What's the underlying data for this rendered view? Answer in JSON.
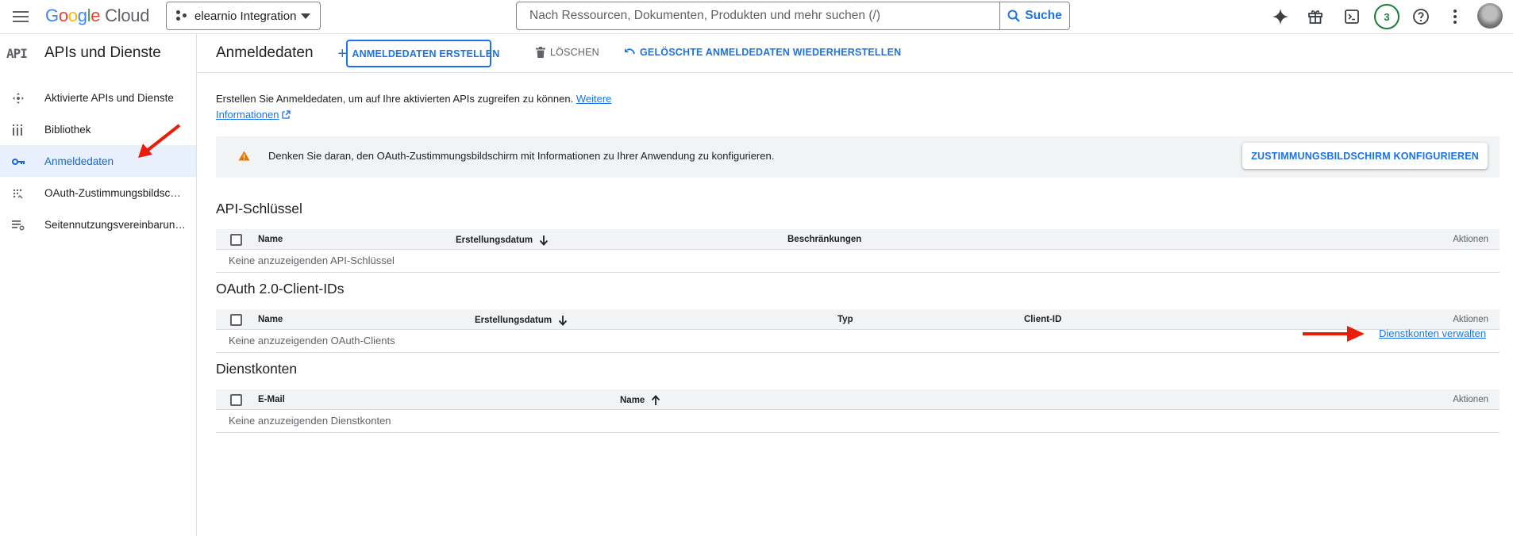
{
  "topbar": {
    "menu_icon": "hamburger-menu-icon",
    "logo": {
      "G": "G",
      "o1": "o",
      "o2": "o",
      "g": "g",
      "l": "l",
      "e": "e",
      "cloud": "Cloud"
    },
    "project": "elearnio Integration",
    "search_placeholder": "Nach Ressourcen, Dokumenten, Produkten und mehr suchen (/)",
    "search_button": "Suche",
    "notification_count": "3",
    "icons": [
      "gemini-sparkle-icon",
      "gift-icon",
      "cloud-shell-icon",
      "help-icon",
      "more-vert-icon"
    ]
  },
  "sidebar": {
    "logo": "API",
    "title": "APIs und Dienste",
    "items": [
      {
        "label": "Aktivierte APIs und Dienste",
        "icon": "enabled-apis-icon"
      },
      {
        "label": "Bibliothek",
        "icon": "library-icon"
      },
      {
        "label": "Anmeldedaten",
        "icon": "key-icon",
        "active": true
      },
      {
        "label": "OAuth-Zustimmungsbildschirm",
        "icon": "oauth-consent-icon"
      },
      {
        "label": "Seitennutzungsvereinbarungen",
        "icon": "page-usage-agreements-icon"
      }
    ]
  },
  "header": {
    "title": "Anmeldedaten",
    "create_button": "ANMELDEDATEN ERSTELLEN",
    "delete_button": "LÖSCHEN",
    "restore_button": "GELÖSCHTE ANMELDEDATEN WIEDERHERSTELLEN"
  },
  "intro": {
    "text": "Erstellen Sie Anmeldedaten, um auf Ihre aktivierten APIs zugreifen zu können.",
    "link_part1": "Weitere",
    "link_part2": "Informationen"
  },
  "notice": {
    "text": "Denken Sie daran, den OAuth-Zustimmungsbildschirm mit Informationen zu Ihrer Anwendung zu konfigurieren.",
    "button": "ZUSTIMMUNGSBILDSCHIRM KONFIGURIEREN"
  },
  "api_keys": {
    "title": "API-Schlüssel",
    "columns": [
      "Name",
      "Erstellungsdatum",
      "Beschränkungen",
      "Aktionen"
    ],
    "empty": "Keine anzuzeigenden API-Schlüssel"
  },
  "oauth": {
    "title": "OAuth 2.0-Client-IDs",
    "columns": [
      "Name",
      "Erstellungsdatum",
      "Typ",
      "Client-ID",
      "Aktionen"
    ],
    "empty": "Keine anzuzeigenden OAuth-Clients"
  },
  "service_accounts": {
    "title": "Dienstkonten",
    "manage_link": "Dienstkonten verwalten",
    "columns": [
      "E-Mail",
      "Name",
      "Aktionen"
    ],
    "empty": "Keine anzuzeigenden Dienstkonten"
  },
  "colors": {
    "accent": "#1a73e8",
    "active_bg": "#e8f0fe",
    "warning": "#e37400",
    "annotation_arrow": "#ea1c0a"
  }
}
